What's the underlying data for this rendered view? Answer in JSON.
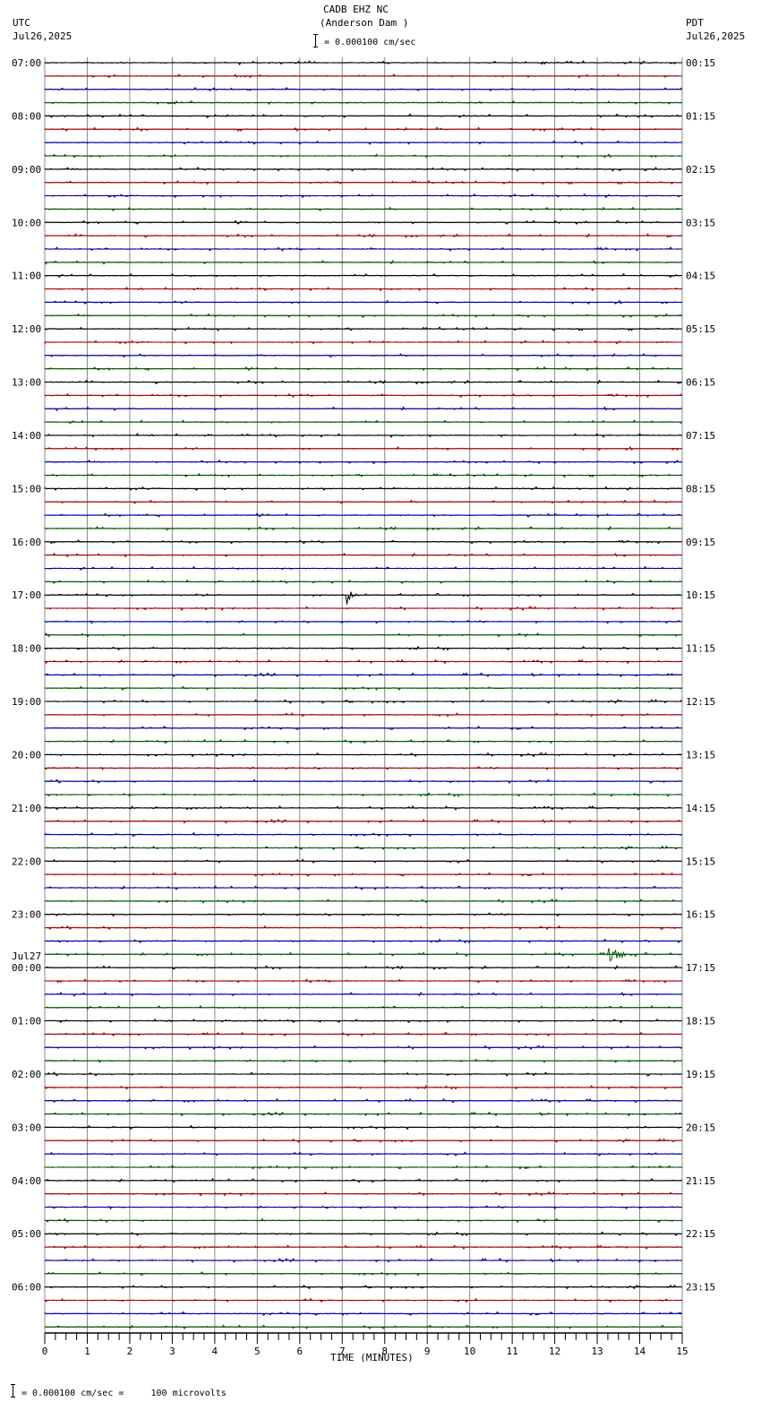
{
  "header": {
    "station": "CADB EHZ NC",
    "location": "(Anderson Dam )",
    "left_tz": "UTC",
    "left_date": "Jul26,2025",
    "right_tz": "PDT",
    "right_date": "Jul26,2025",
    "scale": "= 0.000100 cm/sec"
  },
  "footer": {
    "scale_note": "= 0.000100 cm/sec =     100 microvolts"
  },
  "chart_data": {
    "type": "line",
    "title": "CADB EHZ NC (Anderson Dam )",
    "xlabel": "TIME (MINUTES)",
    "xlim": [
      0,
      15
    ],
    "x_ticks": [
      "0",
      "1",
      "2",
      "3",
      "4",
      "5",
      "6",
      "7",
      "8",
      "9",
      "10",
      "11",
      "12",
      "13",
      "14",
      "15"
    ],
    "trace_minutes": 15,
    "trace_count": 96,
    "trace_colors": [
      "#000000",
      "#cc0000",
      "#0000cc",
      "#006600"
    ],
    "date_change_label": "Jul27",
    "left_labels": [
      "07:00",
      "08:00",
      "09:00",
      "10:00",
      "11:00",
      "12:00",
      "13:00",
      "14:00",
      "15:00",
      "16:00",
      "17:00",
      "18:00",
      "19:00",
      "20:00",
      "21:00",
      "22:00",
      "23:00",
      "00:00",
      "01:00",
      "02:00",
      "03:00",
      "04:00",
      "05:00",
      "06:00"
    ],
    "right_labels": [
      "00:15",
      "01:15",
      "02:15",
      "03:15",
      "04:15",
      "05:15",
      "06:15",
      "07:15",
      "08:15",
      "09:15",
      "10:15",
      "11:15",
      "12:15",
      "13:15",
      "14:15",
      "15:15",
      "16:15",
      "17:15",
      "18:15",
      "19:15",
      "20:15",
      "21:15",
      "22:15",
      "23:15"
    ],
    "events": [
      {
        "trace": 40,
        "minute": 7.1,
        "amplitude": 12,
        "duration_min": 0.4
      },
      {
        "trace": 67,
        "minute": 13.25,
        "amplitude": 14,
        "duration_min": 0.8
      },
      {
        "trace": 73,
        "minute": 3.7,
        "amplitude": 3,
        "duration_min": 0.35
      }
    ]
  }
}
